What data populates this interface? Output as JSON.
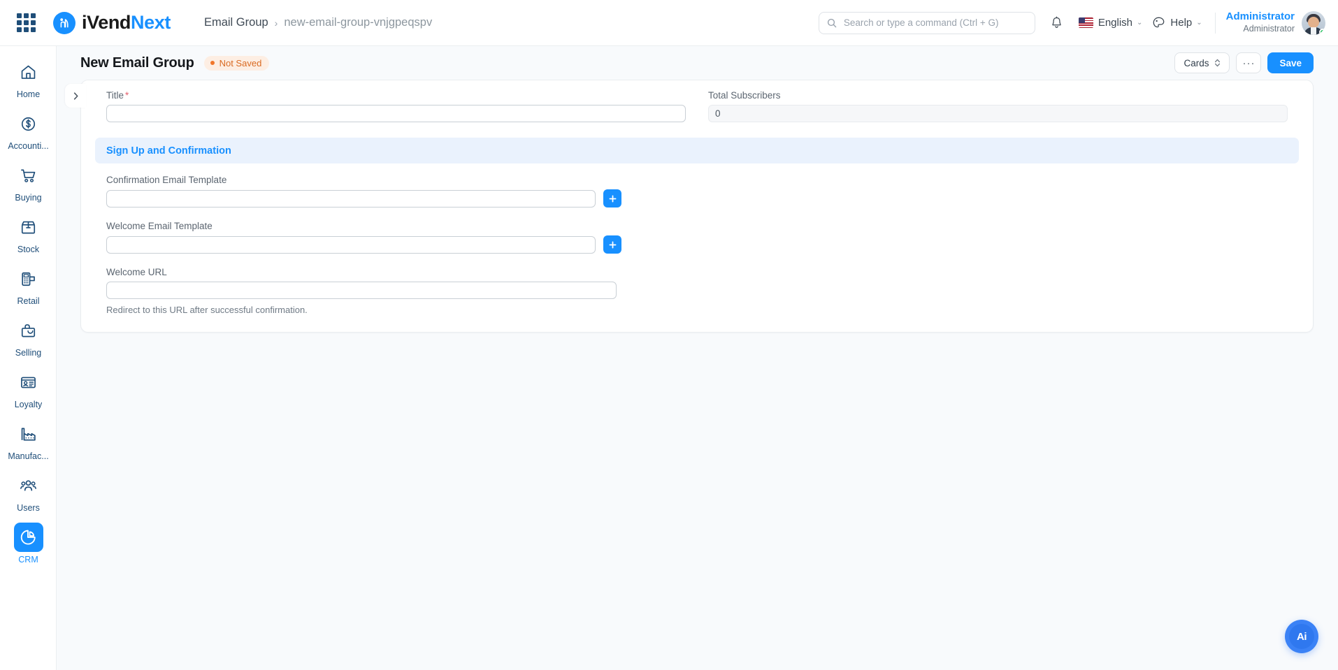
{
  "navbar": {
    "apps_icon": "grid-apps-icon",
    "brand": {
      "text_dark": "iVend",
      "text_blue": "Next",
      "mark": "ivend-logo-mark"
    },
    "breadcrumb": {
      "parent": "Email Group",
      "separator": "›",
      "current": "new-email-group-vnjgpeqspv"
    },
    "search": {
      "placeholder": "Search or type a command (Ctrl + G)",
      "value": "",
      "icon": "search-icon"
    },
    "notifications_icon": "bell-icon",
    "language": {
      "label": "English",
      "flag": "us-flag-icon",
      "caret": "⌄"
    },
    "help": {
      "label": "Help",
      "icon": "palette-icon",
      "caret": "⌄"
    },
    "user": {
      "name": "Administrator",
      "role": "Administrator",
      "status": "online"
    }
  },
  "sidebar": {
    "items": [
      {
        "label": "Home",
        "icon": "home-icon",
        "active": false
      },
      {
        "label": "Accounti...",
        "icon": "dollar-circle-icon",
        "active": false
      },
      {
        "label": "Buying",
        "icon": "shopping-cart-icon",
        "active": false
      },
      {
        "label": "Stock",
        "icon": "box-icon",
        "active": false
      },
      {
        "label": "Retail",
        "icon": "pos-terminal-icon",
        "active": false
      },
      {
        "label": "Selling",
        "icon": "shopping-bag-icon",
        "active": false
      },
      {
        "label": "Loyalty",
        "icon": "id-card-icon",
        "active": false
      },
      {
        "label": "Manufac...",
        "icon": "factory-icon",
        "active": false
      },
      {
        "label": "Users",
        "icon": "users-icon",
        "active": false
      },
      {
        "label": "CRM",
        "icon": "pie-chart-icon",
        "active": true
      }
    ]
  },
  "page": {
    "title": "New Email Group",
    "status": {
      "label": "Not Saved",
      "color": "#d96a22",
      "dot_color": "#f0762a"
    },
    "actions": {
      "view_mode_label": "Cards",
      "view_mode_icon": "updown-chevrons-icon",
      "more_label": "···",
      "save_label": "Save"
    },
    "collapse_icon": "chevron-right-icon"
  },
  "form": {
    "title_field": {
      "label": "Title",
      "required": true,
      "value": "",
      "placeholder": ""
    },
    "total_subscribers": {
      "label": "Total Subscribers",
      "value": "0",
      "readonly": true
    },
    "section": {
      "title": "Sign Up and Confirmation",
      "fields": [
        {
          "label": "Confirmation Email Template",
          "value": "",
          "placeholder": "",
          "add_button": "+",
          "name": "confirmation-email-template"
        },
        {
          "label": "Welcome Email Template",
          "value": "",
          "placeholder": "",
          "add_button": "+",
          "name": "welcome-email-template"
        }
      ],
      "welcome_url": {
        "label": "Welcome URL",
        "value": "",
        "placeholder": "",
        "help": "Redirect to this URL after successful confirmation."
      }
    }
  },
  "fab": {
    "label": "Ai",
    "name": "ai-assistant-button"
  },
  "colors": {
    "accent": "#1890ff",
    "sidebar_icon": "#1f4e79",
    "page_bg": "#f8fafc",
    "section_band": "#eaf2fd",
    "status_bg": "#fdeee3"
  }
}
